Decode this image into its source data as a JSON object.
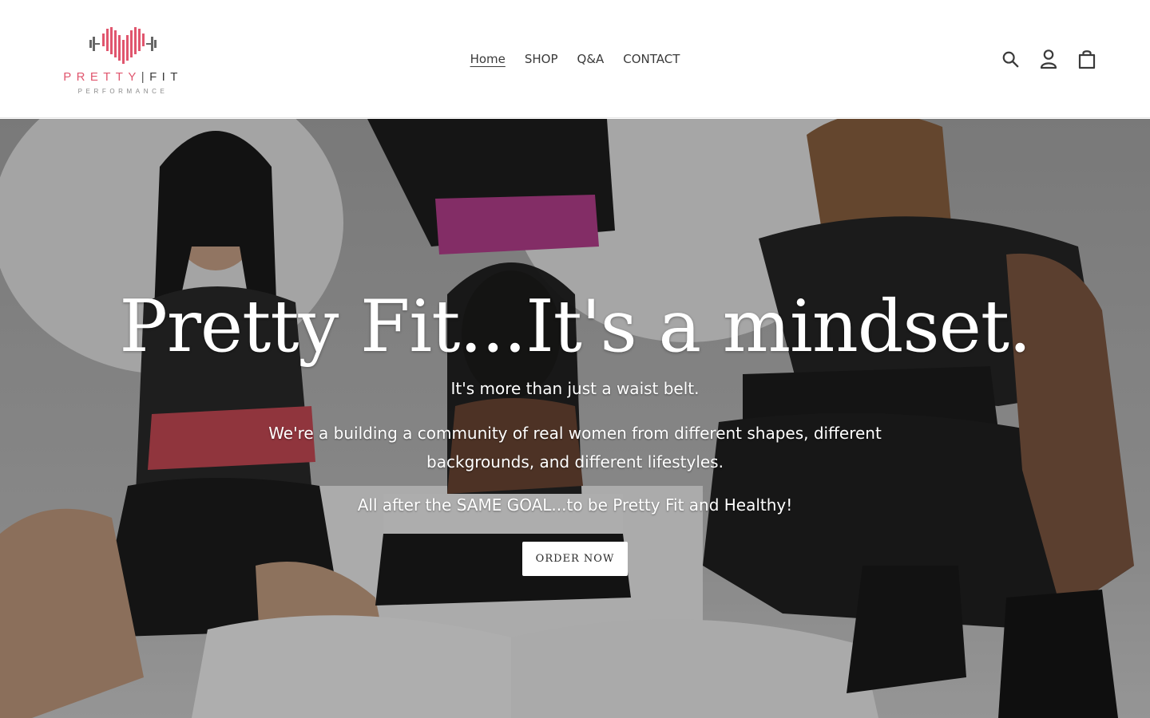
{
  "brand": {
    "name_pretty": "PRETTY",
    "name_separator": "|",
    "name_fit": "FIT",
    "tagline": "PERFORMANCE",
    "primary_color": "#e0566e",
    "logo_icon": "dumbbell-heart-icon"
  },
  "nav": {
    "items": [
      {
        "label": "Home",
        "active": true
      },
      {
        "label": "SHOP",
        "active": false
      },
      {
        "label": "Q&A",
        "active": false
      },
      {
        "label": "CONTACT",
        "active": false
      }
    ]
  },
  "header_icons": [
    "search-icon",
    "account-icon",
    "cart-icon"
  ],
  "hero": {
    "title": "Pretty Fit...It's a mindset.",
    "line1": "It's more than just a waist belt.",
    "line2": "We're a building a community of real women from different shapes, different backgrounds, and different lifestyles.",
    "line3": "All after the SAME GOAL...to be Pretty Fit and Healthy!",
    "button_label": "ORDER NOW"
  }
}
